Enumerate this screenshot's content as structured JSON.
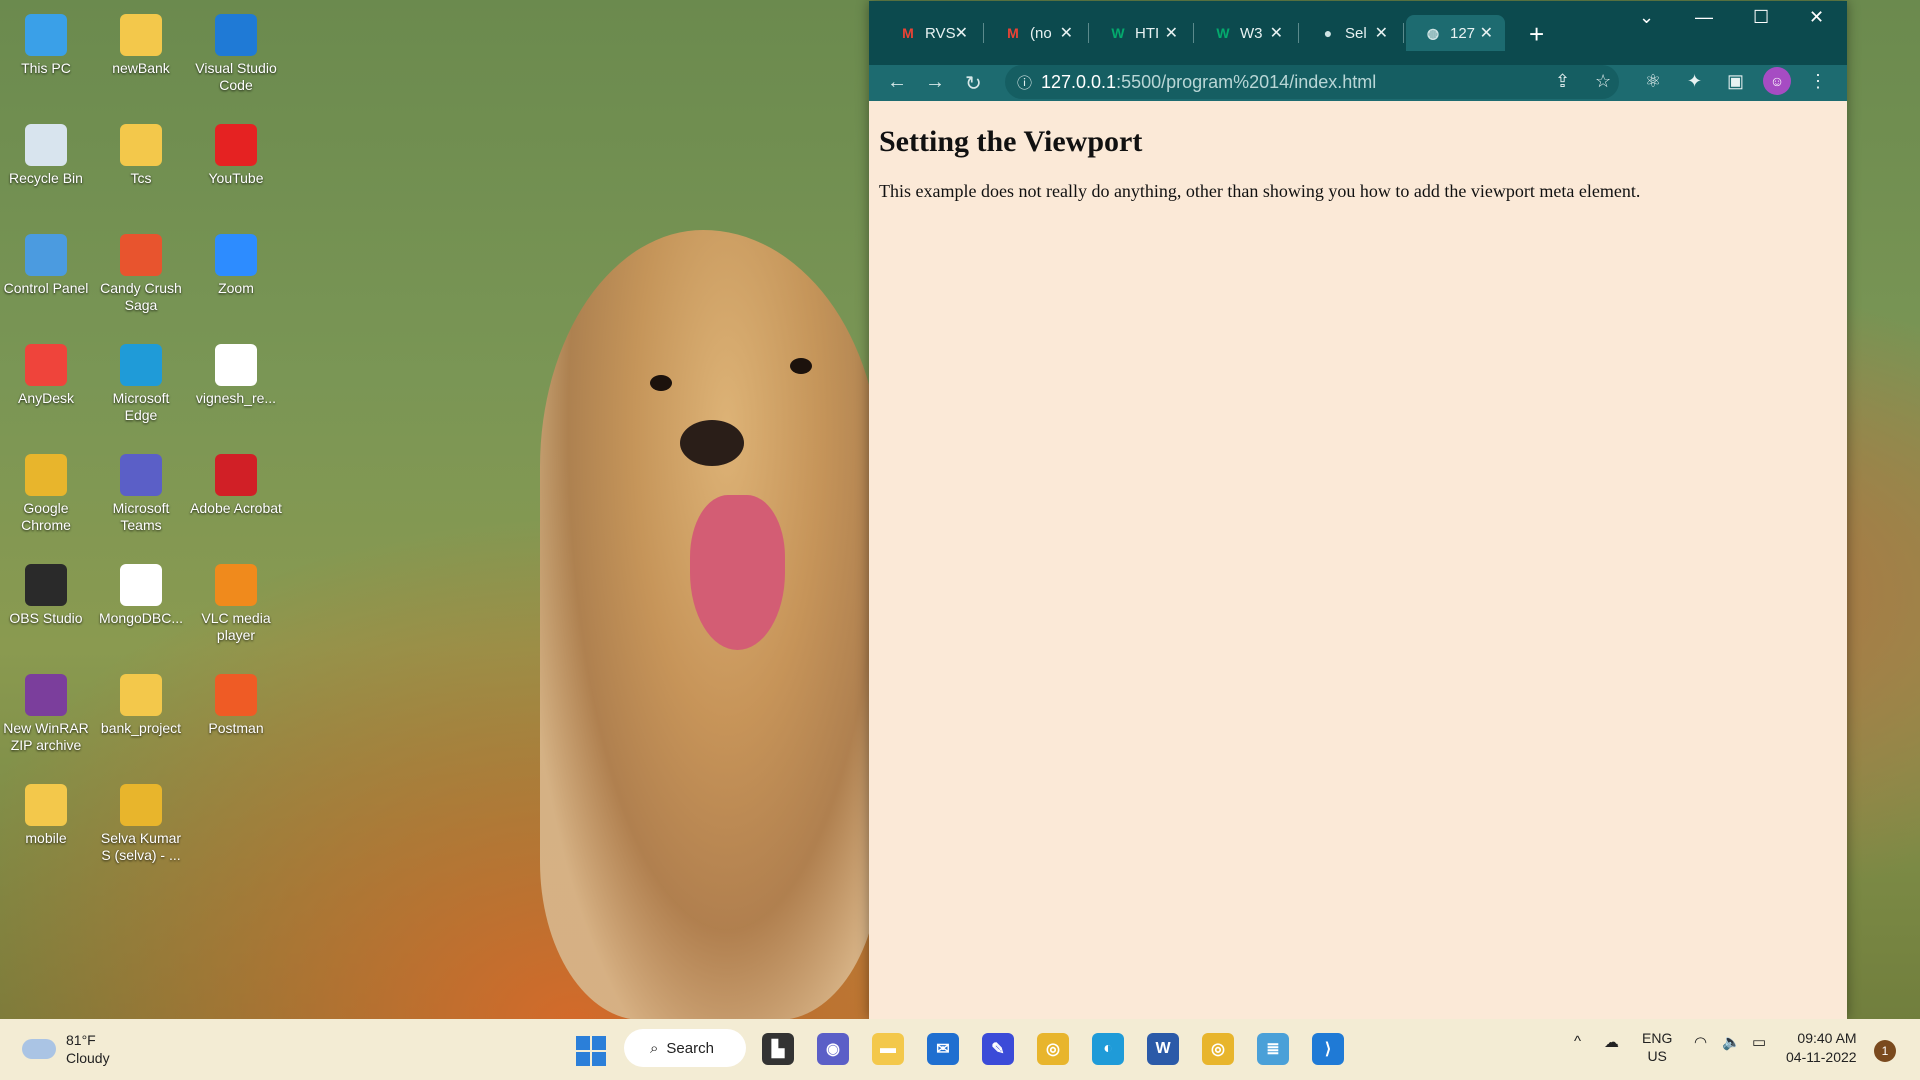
{
  "desktop": {
    "icons": [
      {
        "label": "This PC",
        "icon": "monitor-icon",
        "color": "#3aa0e8"
      },
      {
        "label": "newBank",
        "icon": "folder-icon",
        "color": "#f3c84b"
      },
      {
        "label": "Visual Studio Code",
        "icon": "vscode-icon",
        "color": "#1f7ad6"
      },
      {
        "label": "Recycle Bin",
        "icon": "recycle-bin-icon",
        "color": "#d8e4ee"
      },
      {
        "label": "Tcs",
        "icon": "folder-icon",
        "color": "#f3c84b"
      },
      {
        "label": "YouTube",
        "icon": "youtube-icon",
        "color": "#e52222"
      },
      {
        "label": "Control Panel",
        "icon": "control-panel-icon",
        "color": "#4b9be0"
      },
      {
        "label": "Candy Crush Saga",
        "icon": "candy-crush-icon",
        "color": "#e8542e"
      },
      {
        "label": "Zoom",
        "icon": "zoom-icon",
        "color": "#2d8cff"
      },
      {
        "label": "AnyDesk",
        "icon": "anydesk-icon",
        "color": "#ef443b"
      },
      {
        "label": "Microsoft Edge",
        "icon": "edge-icon",
        "color": "#1f9bd8"
      },
      {
        "label": "vignesh_re...",
        "icon": "pdf-icon",
        "color": "#ffffff"
      },
      {
        "label": "Google Chrome",
        "icon": "chrome-icon",
        "color": "#e8b52c"
      },
      {
        "label": "Microsoft Teams",
        "icon": "teams-icon",
        "color": "#5b5fc7"
      },
      {
        "label": "Adobe Acrobat",
        "icon": "acrobat-icon",
        "color": "#d11f26"
      },
      {
        "label": "OBS Studio",
        "icon": "obs-icon",
        "color": "#2a2a2a"
      },
      {
        "label": "MongoDBC...",
        "icon": "mongodb-icon",
        "color": "#ffffff"
      },
      {
        "label": "VLC media player",
        "icon": "vlc-icon",
        "color": "#f08a1c"
      },
      {
        "label": "New WinRAR ZIP archive",
        "icon": "winrar-icon",
        "color": "#7b3e9c"
      },
      {
        "label": "bank_project",
        "icon": "folder-icon",
        "color": "#f3c84b"
      },
      {
        "label": "Postman",
        "icon": "postman-icon",
        "color": "#ef5b25"
      },
      {
        "label": "mobile",
        "icon": "folder-icon",
        "color": "#f3c84b"
      },
      {
        "label": "Selva Kumar S (selva) - ...",
        "icon": "chrome-profile-icon",
        "color": "#e8b52c"
      }
    ]
  },
  "browser": {
    "tabs": [
      {
        "label": "RVS",
        "icon": "gmail-icon"
      },
      {
        "label": "(no",
        "icon": "gmail-icon"
      },
      {
        "label": "HTI",
        "icon": "w3schools-icon"
      },
      {
        "label": "W3",
        "icon": "w3schools-icon"
      },
      {
        "label": "Sel",
        "icon": "github-icon"
      },
      {
        "label": "127",
        "icon": "globe-icon",
        "active": true
      }
    ],
    "url_host": "127.0.0.1",
    "url_path": ":5500/program%2014/index.html",
    "page": {
      "heading": "Setting the Viewport",
      "paragraph": "This example does not really do anything, other than showing you how to add the viewport meta element."
    },
    "colors": {
      "frame": "#0c4a4e",
      "toolbar": "#1d6b70",
      "page_bg": "#fbe9d7"
    }
  },
  "taskbar": {
    "weather_temp": "81°F",
    "weather_desc": "Cloudy",
    "search_label": "Search",
    "apps": [
      {
        "icon": "task-view-icon",
        "color": "#333333"
      },
      {
        "icon": "teams-chat-icon",
        "color": "#5b5fc7"
      },
      {
        "icon": "file-explorer-icon",
        "color": "#f3c84b"
      },
      {
        "icon": "mail-icon",
        "color": "#1f6fd0"
      },
      {
        "icon": "whiteboard-icon",
        "color": "#3b4bd8"
      },
      {
        "icon": "chrome-icon",
        "color": "#e8b52c"
      },
      {
        "icon": "edge-icon",
        "color": "#1f9bd8"
      },
      {
        "icon": "word-icon",
        "color": "#2b5aa8"
      },
      {
        "icon": "chrome-profile-icon",
        "color": "#e8b52c"
      },
      {
        "icon": "notepad-icon",
        "color": "#4aa0d8"
      },
      {
        "icon": "vscode-icon",
        "color": "#1f7ad6"
      }
    ],
    "lang": "ENG",
    "region": "US",
    "time": "09:40 AM",
    "date": "04-11-2022",
    "notification_count": "1"
  }
}
